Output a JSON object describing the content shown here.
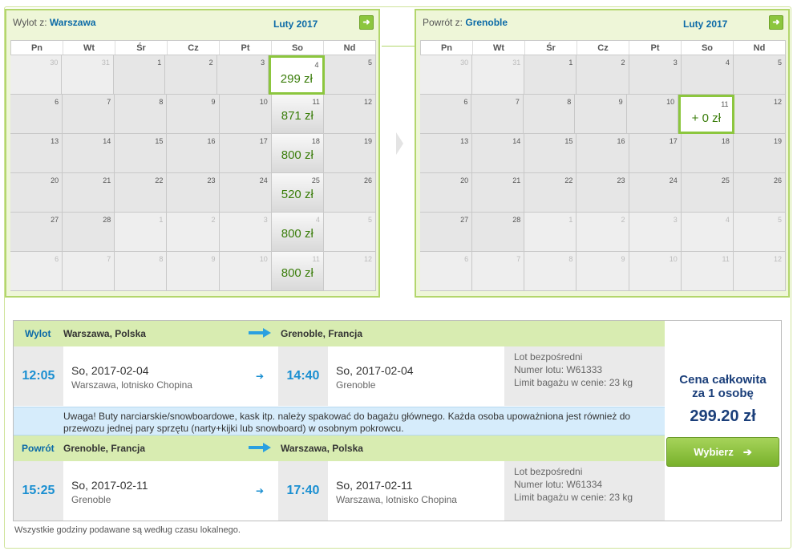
{
  "outbound_calendar": {
    "label": "Wylot z:",
    "city": "Warszawa",
    "month": "Luty 2017",
    "next_icon": "arrow-right-icon",
    "weekdays": [
      "Pn",
      "Wt",
      "Śr",
      "Cz",
      "Pt",
      "So",
      "Nd"
    ],
    "weeks": [
      [
        {
          "d": "30",
          "out": true
        },
        {
          "d": "31",
          "out": true
        },
        {
          "d": "1"
        },
        {
          "d": "2"
        },
        {
          "d": "3"
        },
        {
          "d": "4",
          "price": "299 zł",
          "selected": true
        },
        {
          "d": "5"
        }
      ],
      [
        {
          "d": "6"
        },
        {
          "d": "7"
        },
        {
          "d": "8"
        },
        {
          "d": "9"
        },
        {
          "d": "10"
        },
        {
          "d": "11",
          "price": "871 zł"
        },
        {
          "d": "12"
        }
      ],
      [
        {
          "d": "13"
        },
        {
          "d": "14"
        },
        {
          "d": "15"
        },
        {
          "d": "16"
        },
        {
          "d": "17"
        },
        {
          "d": "18",
          "price": "800 zł"
        },
        {
          "d": "19"
        }
      ],
      [
        {
          "d": "20"
        },
        {
          "d": "21"
        },
        {
          "d": "22"
        },
        {
          "d": "23"
        },
        {
          "d": "24"
        },
        {
          "d": "25",
          "price": "520 zł"
        },
        {
          "d": "26"
        }
      ],
      [
        {
          "d": "27"
        },
        {
          "d": "28"
        },
        {
          "d": "1",
          "out": true
        },
        {
          "d": "2",
          "out": true
        },
        {
          "d": "3",
          "out": true
        },
        {
          "d": "4",
          "price": "800 zł",
          "out": true
        },
        {
          "d": "5",
          "out": true
        }
      ],
      [
        {
          "d": "6",
          "out": true
        },
        {
          "d": "7",
          "out": true
        },
        {
          "d": "8",
          "out": true
        },
        {
          "d": "9",
          "out": true
        },
        {
          "d": "10",
          "out": true
        },
        {
          "d": "11",
          "price": "800 zł",
          "out": true
        },
        {
          "d": "12",
          "out": true
        }
      ]
    ]
  },
  "return_calendar": {
    "label": "Powrót z:",
    "city": "Grenoble",
    "month": "Luty 2017",
    "next_icon": "arrow-right-icon",
    "weekdays": [
      "Pn",
      "Wt",
      "Śr",
      "Cz",
      "Pt",
      "So",
      "Nd"
    ],
    "weeks": [
      [
        {
          "d": "30",
          "out": true
        },
        {
          "d": "31",
          "out": true
        },
        {
          "d": "1"
        },
        {
          "d": "2"
        },
        {
          "d": "3"
        },
        {
          "d": "4"
        },
        {
          "d": "5"
        }
      ],
      [
        {
          "d": "6"
        },
        {
          "d": "7"
        },
        {
          "d": "8"
        },
        {
          "d": "9"
        },
        {
          "d": "10"
        },
        {
          "d": "11",
          "price": "+ 0 zł",
          "selected": true
        },
        {
          "d": "12"
        }
      ],
      [
        {
          "d": "13"
        },
        {
          "d": "14"
        },
        {
          "d": "15"
        },
        {
          "d": "16"
        },
        {
          "d": "17"
        },
        {
          "d": "18"
        },
        {
          "d": "19"
        }
      ],
      [
        {
          "d": "20"
        },
        {
          "d": "21"
        },
        {
          "d": "22"
        },
        {
          "d": "23"
        },
        {
          "d": "24"
        },
        {
          "d": "25"
        },
        {
          "d": "26"
        }
      ],
      [
        {
          "d": "27"
        },
        {
          "d": "28"
        },
        {
          "d": "1",
          "out": true
        },
        {
          "d": "2",
          "out": true
        },
        {
          "d": "3",
          "out": true
        },
        {
          "d": "4",
          "out": true
        },
        {
          "d": "5",
          "out": true
        }
      ],
      [
        {
          "d": "6",
          "out": true
        },
        {
          "d": "7",
          "out": true
        },
        {
          "d": "8",
          "out": true
        },
        {
          "d": "9",
          "out": true
        },
        {
          "d": "10",
          "out": true
        },
        {
          "d": "11",
          "out": true
        },
        {
          "d": "12",
          "out": true
        }
      ]
    ]
  },
  "outbound": {
    "label": "Wylot",
    "from": "Warszawa, Polska",
    "to": "Grenoble, Francja",
    "dep_time": "12:05",
    "dep_date": "So, 2017-02-04",
    "dep_place": "Warszawa, lotnisko Chopina",
    "arr_time": "14:40",
    "arr_date": "So, 2017-02-04",
    "arr_place": "Grenoble",
    "info1": "Lot bezpośredni",
    "info2": "Numer lotu: W61333",
    "info3": "Limit bagażu w cenie: 23 kg"
  },
  "warning": "Uwaga! Buty narciarskie/snowboardowe, kask itp. należy spakować do bagażu głównego. Każda osoba upoważniona jest również do przewozu jednej pary sprzętu (narty+kijki lub snowboard) w osobnym pokrowcu.",
  "return": {
    "label": "Powrót",
    "from": "Grenoble, Francja",
    "to": "Warszawa, Polska",
    "dep_time": "15:25",
    "dep_date": "So, 2017-02-11",
    "dep_place": "Grenoble",
    "arr_time": "17:40",
    "arr_date": "So, 2017-02-11",
    "arr_place": "Warszawa, lotnisko Chopina",
    "info1": "Lot bezpośredni",
    "info2": "Numer lotu: W61334",
    "info3": "Limit bagażu w cenie: 23 kg"
  },
  "price": {
    "label": "Cena całkowita\nza 1 osobę",
    "value": "299.20 zł",
    "button": "Wybierz",
    "button_icon": "arrow-right-icon"
  },
  "footnote": "Wszystkie godziny podawane są według czasu lokalnego.",
  "colors": {
    "accent_green": "#8cc63e",
    "price_green": "#3a7d0a",
    "blue": "#1a8fd1",
    "navy": "#1b3f7a"
  }
}
